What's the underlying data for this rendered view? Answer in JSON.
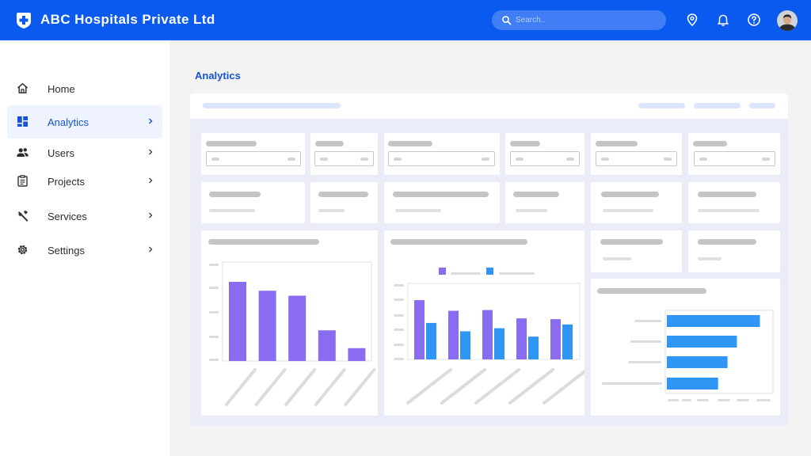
{
  "app": {
    "title": "ABC Hospitals Private Ltd",
    "logo_icon": "hospital-cross-shield-icon"
  },
  "search": {
    "placeholder": "Search.."
  },
  "header_icons": [
    "location-pin-icon",
    "bell-icon",
    "help-icon"
  ],
  "sidebar": {
    "items": [
      {
        "label": "Home",
        "icon": "home-icon",
        "has_chevron": false,
        "active": false
      },
      {
        "label": "Analytics",
        "icon": "dashboard-icon",
        "has_chevron": true,
        "active": true
      },
      {
        "label": "Users",
        "icon": "users-icon",
        "has_chevron": true,
        "active": false
      },
      {
        "label": "Projects",
        "icon": "clipboard-icon",
        "has_chevron": true,
        "active": false
      },
      {
        "label": "Services",
        "icon": "wrench-icon",
        "has_chevron": true,
        "active": false
      },
      {
        "label": "Settings",
        "icon": "gear-icon",
        "has_chevron": true,
        "active": false
      }
    ]
  },
  "page": {
    "title": "Analytics"
  },
  "colors": {
    "brand": "#0a5af0",
    "accent_text": "#1553d6",
    "series_purple": "#8a6cf0",
    "series_blue": "#2f96f5",
    "placeholder": "#c5c5c5"
  },
  "chart_data": [
    {
      "type": "bar",
      "values": [
        80,
        71,
        66,
        31,
        13
      ],
      "ylim": [
        0,
        100
      ]
    },
    {
      "type": "bar",
      "series": [
        {
          "values": [
            78,
            64,
            65,
            54,
            53
          ]
        },
        {
          "values": [
            48,
            37,
            41,
            30,
            46
          ]
        }
      ],
      "ylim": [
        0,
        100
      ]
    },
    {
      "type": "bar",
      "orientation": "horizontal",
      "values": [
        89,
        67,
        58,
        49
      ],
      "xlim": [
        0,
        100
      ]
    }
  ]
}
